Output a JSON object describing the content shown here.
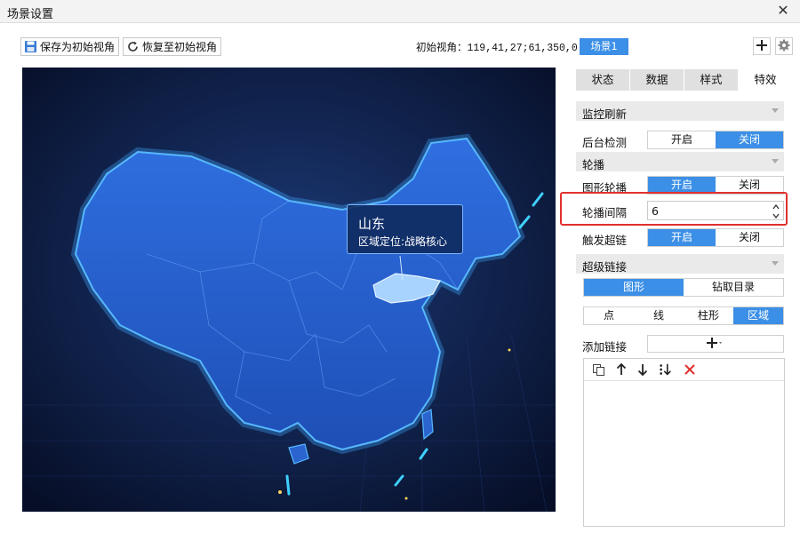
{
  "window": {
    "title": "场景设置",
    "close_glyph": "✕"
  },
  "toolbar": {
    "save_label": "保存为初始视角",
    "restore_label": "恢复至初始视角",
    "view_label": "初始视角：",
    "view_value": "119,41,27;61,350,0",
    "scene_label": "场景1"
  },
  "tooltip": {
    "region": "山东",
    "desc": "区域定位:战略核心"
  },
  "tabs": [
    {
      "label": "状态",
      "active": false
    },
    {
      "label": "数据",
      "active": false
    },
    {
      "label": "样式",
      "active": false
    },
    {
      "label": "特效",
      "active": true
    }
  ],
  "sections": {
    "monitor": "监控刷新",
    "carousel": "轮播",
    "hyperlink": "超级链接"
  },
  "monitor": {
    "bg_check_label": "后台检测",
    "on": "开启",
    "off": "关闭",
    "selected": "off"
  },
  "carousel": {
    "shape_label": "图形轮播",
    "on": "开启",
    "off": "关闭",
    "selected": "on",
    "interval_label": "轮播间隔",
    "interval_value": "6",
    "trigger_label": "触发超链",
    "trigger_on": "开启",
    "trigger_off": "关闭",
    "trigger_selected": "on"
  },
  "hyperlink": {
    "mode_tabs": [
      "图形",
      "钻取目录"
    ],
    "mode_active": "图形",
    "type_tabs": [
      "点",
      "线",
      "柱形",
      "区域"
    ],
    "type_active": "区域",
    "add_label": "添加链接"
  },
  "icons": {
    "save": "save-icon",
    "restore": "refresh-icon",
    "add": "plus-icon",
    "gear": "gear-icon"
  },
  "colors": {
    "accent": "#3c8fe6",
    "highlight": "#e0312e",
    "map_bg": "#0a1535"
  }
}
